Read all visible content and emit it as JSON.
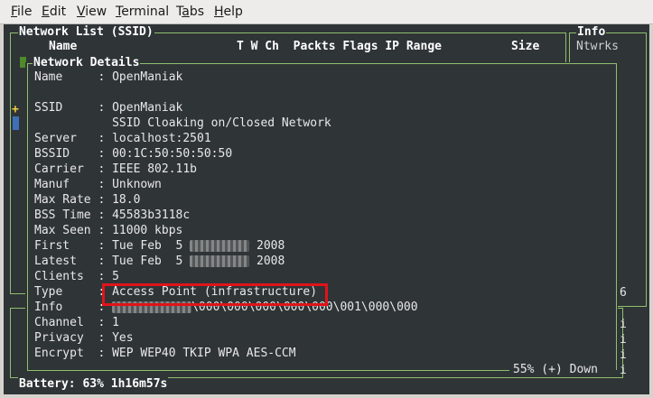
{
  "menubar": {
    "file": "File",
    "edit": "Edit",
    "view": "View",
    "terminal": "Terminal",
    "tabs": "Tabs",
    "help": "Help"
  },
  "network_list": {
    "title": "Network List (SSID)",
    "col_name": "Name",
    "col_flags": "T W Ch  Packts Flags IP Range",
    "col_size": "Size"
  },
  "info_panel": {
    "title": "Info",
    "label": "Ntwrks",
    "count": "6",
    "markers": [
      "i",
      "i",
      "i",
      "i"
    ]
  },
  "details": {
    "title": "Network Details",
    "rows": [
      {
        "label": "Name     : ",
        "value": "OpenManiak"
      },
      {
        "label": "SSID     : ",
        "value": "OpenManiak"
      },
      {
        "label": "           ",
        "value": "SSID Cloaking on/Closed Network"
      },
      {
        "label": "Server   : ",
        "value": "localhost:2501"
      },
      {
        "label": "BSSID    : ",
        "value": "00:1C:50:50:50:50"
      },
      {
        "label": "Carrier  : ",
        "value": "IEEE 802.11b"
      },
      {
        "label": "Manuf    : ",
        "value": "Unknown"
      },
      {
        "label": "Max Rate : ",
        "value": "18.0"
      },
      {
        "label": "BSS Time : ",
        "value": "45583b3118c"
      },
      {
        "label": "Max Seen : ",
        "value": "11000 kbps"
      },
      {
        "label": "First    : ",
        "value_pre": "Tue Feb  5 ",
        "value_post": " 2008"
      },
      {
        "label": "Latest   : ",
        "value_pre": "Tue Feb  5 ",
        "value_post": " 2008"
      },
      {
        "label": "Clients  : ",
        "value": "5"
      },
      {
        "label": "Type     : ",
        "value": "Access Point (infrastructure)"
      },
      {
        "label": "Info     : ",
        "value_post": "\\000\\000\\000\\000\\000\\001\\000\\000"
      },
      {
        "label": "Channel  : ",
        "value": "1"
      },
      {
        "label": "Privacy  : ",
        "value": "Yes"
      },
      {
        "label": "Encrypt  : ",
        "value": "WEP WEP40 TKIP WPA AES-CCM"
      }
    ],
    "scroll_status": "55% (+) Down"
  },
  "status": {
    "battery": "Battery: 63% 1h16m57s"
  },
  "side_marks": {
    "plus": "+"
  },
  "colors": {
    "terminal_bg": "#2f3437",
    "frame": "#8fbf6c",
    "highlight": "#e0141a",
    "marker_yellow": "#f2d23c",
    "marker_blue": "#3f6fb8"
  }
}
